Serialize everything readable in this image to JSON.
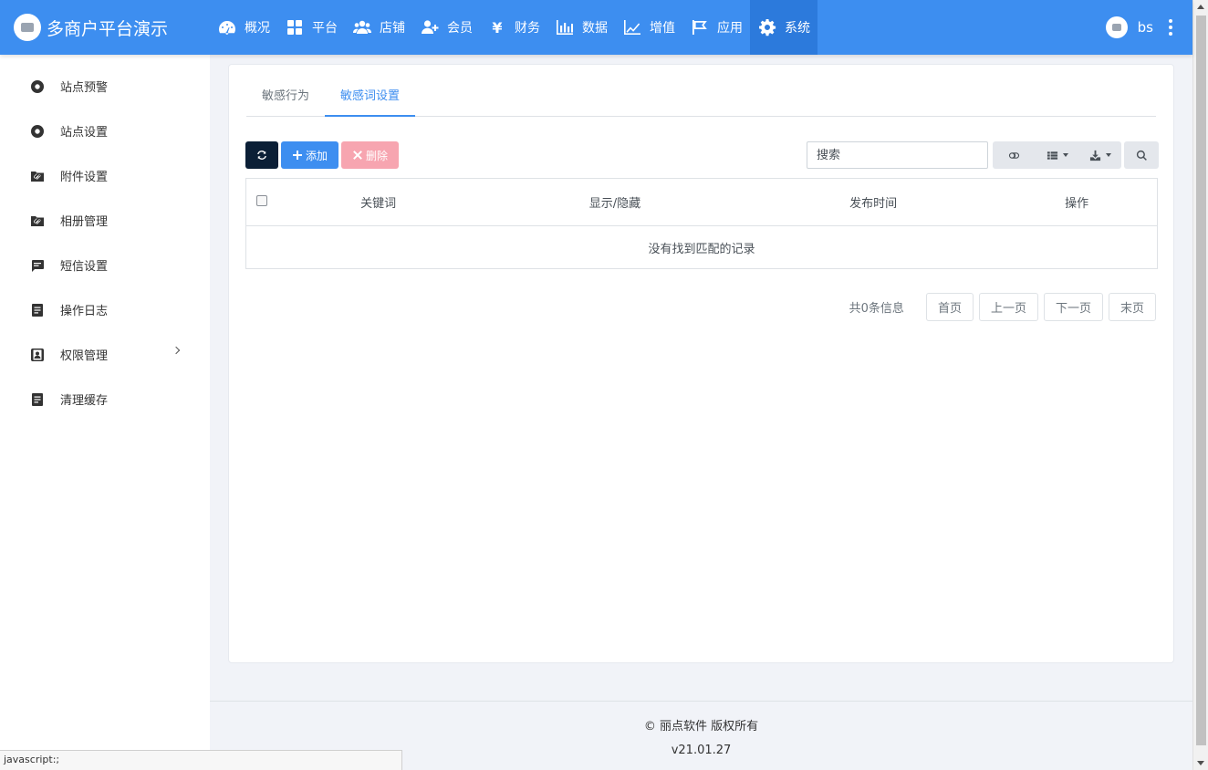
{
  "brand": {
    "title": "多商户平台演示"
  },
  "nav": {
    "items": [
      {
        "label": "概况",
        "icon": "dashboard-icon"
      },
      {
        "label": "平台",
        "icon": "grid-icon"
      },
      {
        "label": "店铺",
        "icon": "users-icon"
      },
      {
        "label": "会员",
        "icon": "user-plus-icon"
      },
      {
        "label": "财务",
        "icon": "yen-icon"
      },
      {
        "label": "数据",
        "icon": "bar-chart-icon"
      },
      {
        "label": "增值",
        "icon": "line-chart-icon"
      },
      {
        "label": "应用",
        "icon": "flag-icon"
      },
      {
        "label": "系统",
        "icon": "gear-icon",
        "active": true
      }
    ]
  },
  "user": {
    "name": "bs"
  },
  "sidebar": {
    "items": [
      {
        "label": "站点预警",
        "icon": "circle-dot-icon"
      },
      {
        "label": "站点设置",
        "icon": "circle-dot-icon"
      },
      {
        "label": "附件设置",
        "icon": "folder-clip-icon"
      },
      {
        "label": "相册管理",
        "icon": "folder-clip-icon"
      },
      {
        "label": "短信设置",
        "icon": "message-icon"
      },
      {
        "label": "操作日志",
        "icon": "document-icon"
      },
      {
        "label": "权限管理",
        "icon": "contact-icon",
        "has_submenu": true
      },
      {
        "label": "清理缓存",
        "icon": "document-icon"
      }
    ]
  },
  "tabs": [
    {
      "label": "敏感行为"
    },
    {
      "label": "敏感词设置",
      "active": true
    }
  ],
  "toolbar": {
    "add_label": "添加",
    "delete_label": "删除",
    "search_placeholder": "搜索"
  },
  "table": {
    "columns": [
      "关键词",
      "显示/隐藏",
      "发布时间",
      "操作"
    ],
    "empty_text": "没有找到匹配的记录"
  },
  "pagination": {
    "info": "共0条信息",
    "first": "首页",
    "prev": "上一页",
    "next": "下一页",
    "last": "末页"
  },
  "footer": {
    "copyright": "© 丽点软件 版权所有",
    "version": "v21.01.27"
  },
  "statusbar": {
    "text": "javascript:;"
  },
  "colors": {
    "primary": "#3d8ef0",
    "dark": "#0b1f36",
    "danger_light": "#f7a5b0"
  }
}
